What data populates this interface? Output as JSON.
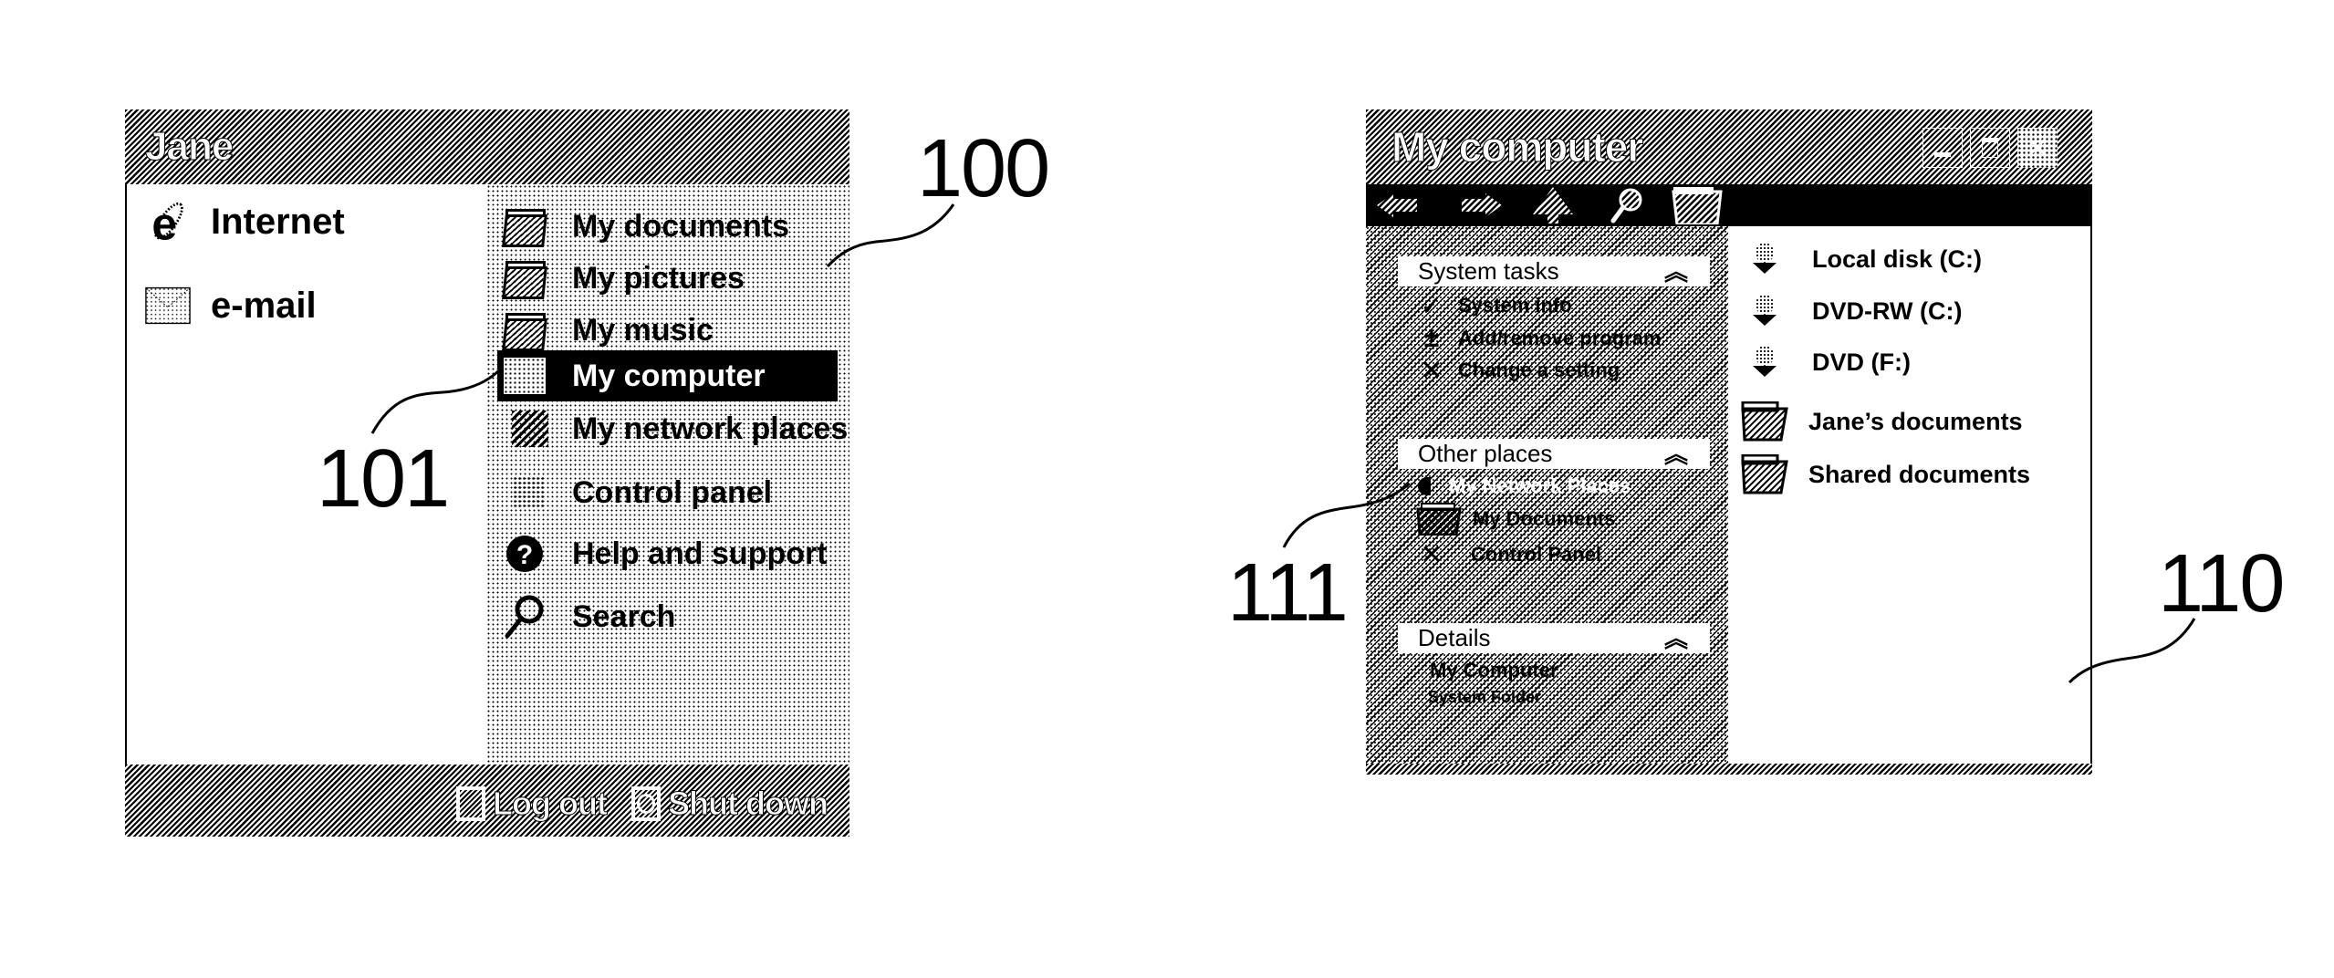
{
  "start_menu": {
    "user_name": "Jane",
    "pinned": [
      {
        "label": "Internet",
        "icon": "internet-explorer-icon"
      },
      {
        "label": "e-mail",
        "icon": "envelope-icon"
      }
    ],
    "places": [
      {
        "label": "My documents",
        "icon": "folder-icon",
        "selected": false
      },
      {
        "label": "My pictures",
        "icon": "folder-icon",
        "selected": false
      },
      {
        "label": "My music",
        "icon": "folder-icon",
        "selected": false
      },
      {
        "label": "My computer",
        "icon": "computer-icon",
        "selected": true
      },
      {
        "label": "My network places",
        "icon": "network-icon",
        "selected": false
      },
      {
        "label": "Control panel",
        "icon": "control-panel-icon",
        "selected": false
      },
      {
        "label": "Help and support",
        "icon": "help-icon",
        "selected": false
      },
      {
        "label": "Search",
        "icon": "search-icon",
        "selected": false
      }
    ],
    "footer": {
      "log_out": "Log out",
      "shut_down": "Shut down"
    }
  },
  "window": {
    "title": "My computer",
    "controls": [
      "minimize",
      "maximize",
      "close"
    ],
    "toolbar": [
      "back",
      "forward",
      "up",
      "search",
      "folders"
    ],
    "task_pane": {
      "sections": [
        {
          "title": "System tasks",
          "items": [
            {
              "label": "System info",
              "icon": "checkmark-icon"
            },
            {
              "label": "Add/remove program",
              "icon": "plus-minus-icon"
            },
            {
              "label": "Change a setting",
              "icon": "tools-icon"
            }
          ]
        },
        {
          "title": "Other places",
          "items": [
            {
              "label": "My Network Places",
              "icon": "network-places-icon",
              "obscured": true
            },
            {
              "label": "My Documents",
              "icon": "folder-icon"
            },
            {
              "label": "Control Panel",
              "icon": "tools-icon"
            }
          ]
        },
        {
          "title": "Details",
          "detail_title": "My Computer",
          "detail_subtitle": "System Folder"
        }
      ]
    },
    "content_items": [
      {
        "label": "Local disk (C:)",
        "icon": "drive-icon"
      },
      {
        "label": "DVD-RW (C:)",
        "icon": "drive-icon"
      },
      {
        "label": "DVD (F:)",
        "icon": "drive-icon"
      },
      {
        "label": "Jane’s documents",
        "icon": "folder-icon"
      },
      {
        "label": "Shared documents",
        "icon": "folder-icon"
      }
    ]
  },
  "reference_numerals": {
    "start_menu": "100",
    "my_computer_item": "101",
    "window": "110",
    "other_places_item": "111"
  }
}
